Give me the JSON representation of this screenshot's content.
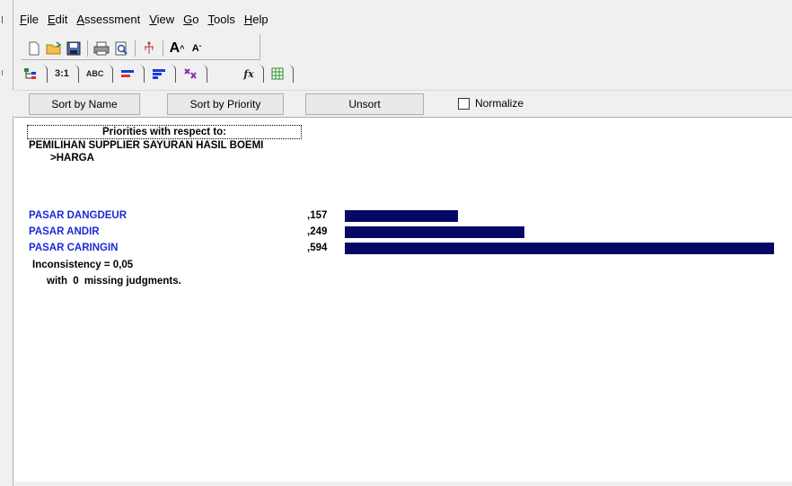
{
  "menu": [
    "File",
    "Edit",
    "Assessment",
    "View",
    "Go",
    "Tools",
    "Help"
  ],
  "toolbar_icons": [
    "new-doc-icon",
    "open-folder-icon",
    "save-icon",
    "print-icon",
    "print-preview-icon",
    "sort-tree-icon",
    "font-larger-icon",
    "font-smaller-icon"
  ],
  "view_tabs": [
    "",
    "3:1",
    "ABC",
    "",
    "",
    "",
    "fx",
    ""
  ],
  "sortbar": {
    "sort_name": "Sort by Name",
    "sort_priority": "Sort by Priority",
    "unsort": "Unsort",
    "normalize": "Normalize"
  },
  "content": {
    "header": "Priorities with respect to:",
    "goal": "PEMILIHAN SUPPLIER SAYURAN HASIL BOEMI",
    "criterion": ">HARGA",
    "items": [
      {
        "label": "PASAR DANGDEUR",
        "value": ",157",
        "priority": 0.157
      },
      {
        "label": "PASAR ANDIR",
        "value": ",249",
        "priority": 0.249
      },
      {
        "label": "PASAR CARINGIN",
        "value": ",594",
        "priority": 0.594
      }
    ],
    "inconsistency": "Inconsistency = 0,05",
    "missing_prefix": "with",
    "missing_count": "0",
    "missing_suffix": "missing judgments."
  },
  "colors": {
    "bar": "#070766",
    "label": "#1a2bd6"
  }
}
